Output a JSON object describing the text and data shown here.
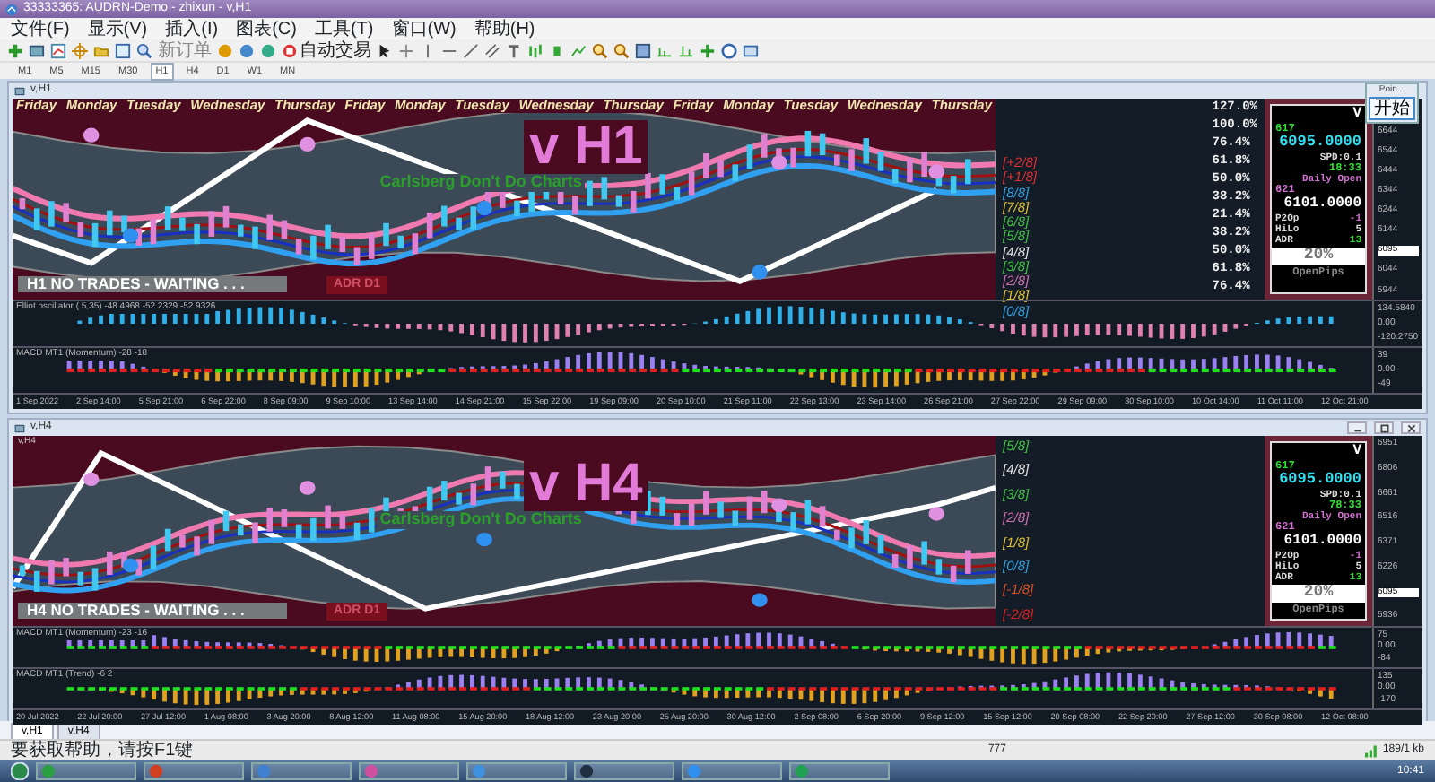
{
  "window": {
    "title": "33333365: AUDRN-Demo - zhixun - v,H1"
  },
  "menu": [
    "文件(F)",
    "显示(V)",
    "插入(I)",
    "图表(C)",
    "工具(T)",
    "窗口(W)",
    "帮助(H)"
  ],
  "toolbar": {
    "new_order": "新订单",
    "autotrading": "自动交易"
  },
  "timeframes": [
    {
      "label": "M1",
      "selected": false
    },
    {
      "label": "M5",
      "selected": false
    },
    {
      "label": "M15",
      "selected": false
    },
    {
      "label": "M30",
      "selected": false
    },
    {
      "label": "H1",
      "selected": true
    },
    {
      "label": "H4",
      "selected": false
    },
    {
      "label": "D1",
      "selected": false
    },
    {
      "label": "W1",
      "selected": false
    },
    {
      "label": "MN",
      "selected": false
    }
  ],
  "charts": [
    {
      "title": "v,H1",
      "controls": false,
      "watermark": "v H1",
      "tagline": "Carlsberg Don't Do Charts",
      "status": "H1  NO TRADES - WAITING . . .",
      "adr_label": "ADR D1",
      "days": [
        "Friday",
        "Monday",
        "Tuesday",
        "Wednesday",
        "Thursday",
        "Friday",
        "Monday",
        "Tuesday",
        "Wednesday",
        "Thursday",
        "Friday",
        "Monday",
        "Tuesday",
        "Wednesday",
        "Thursday"
      ],
      "murrey": [
        {
          "label": "[+2/8]",
          "color": "#e03030"
        },
        {
          "label": "[+1/8]",
          "color": "#e03030"
        },
        {
          "label": "[8/8]",
          "color": "#30a0e0"
        },
        {
          "label": "[7/8]",
          "color": "#e0c030"
        },
        {
          "label": "[6/8]",
          "color": "#40c040"
        },
        {
          "label": "[5/8]",
          "color": "#40c040"
        },
        {
          "label": "[4/8]",
          "color": "#e0e0e0"
        },
        {
          "label": "[3/8]",
          "color": "#40c040"
        },
        {
          "label": "[2/8]",
          "color": "#d070b0"
        },
        {
          "label": "[1/8]",
          "color": "#e0c030"
        },
        {
          "label": "[0/8]",
          "color": "#30a0e0"
        }
      ],
      "percent_levels": [
        "127.0%",
        "100.0%",
        "76.4%",
        "61.8%",
        "50.0%",
        "38.2%",
        "21.4%",
        "38.2%",
        "50.0%",
        "61.8%",
        "76.4%"
      ],
      "info": {
        "symbol": "V",
        "price_small": "617",
        "price": "6095.0000",
        "spd": "SPD:0.1",
        "timer": "18:33",
        "daily_open_label": "Daily Open",
        "daily_open_small": "621",
        "daily_open": "6101.0000",
        "rows": [
          {
            "label": "P2Op",
            "value": "-1"
          },
          {
            "label": "HiLo",
            "value": "5"
          },
          {
            "label": "ADR",
            "value": "13"
          }
        ],
        "percent": "20%",
        "open_pips": "OpenPips"
      },
      "price_axis": [
        {
          "label": "6644",
          "current": false
        },
        {
          "label": "6544",
          "current": false
        },
        {
          "label": "6444",
          "current": false
        },
        {
          "label": "6344",
          "current": false
        },
        {
          "label": "6244",
          "current": false
        },
        {
          "label": "6144",
          "current": false
        },
        {
          "label": "6095",
          "current": true
        },
        {
          "label": "6044",
          "current": false
        },
        {
          "label": "5944",
          "current": false
        }
      ],
      "sub_panes": [
        {
          "kind": "histogram",
          "title": "Elliot oscillator ( 5,35) -48.4968 -52.2329 -52.9326",
          "axis": [
            "134.5840",
            "0.00",
            "-120.2750"
          ]
        },
        {
          "kind": "macd",
          "title": "MACD MT1 (Momentum) -28 -18",
          "axis": [
            "39",
            "0.00",
            "-49"
          ]
        }
      ],
      "dates": [
        "1 Sep 2022",
        "2 Sep 14:00",
        "5 Sep 21:00",
        "6 Sep 22:00",
        "8 Sep 09:00",
        "9 Sep 10:00",
        "13 Sep 14:00",
        "14 Sep 21:00",
        "15 Sep 22:00",
        "19 Sep 09:00",
        "20 Sep 10:00",
        "21 Sep 11:00",
        "22 Sep 13:00",
        "23 Sep 14:00",
        "26 Sep 21:00",
        "27 Sep 22:00",
        "29 Sep 09:00",
        "30 Sep 10:00",
        "10 Oct 14:00",
        "11 Oct 11:00",
        "12 Oct 21:00"
      ]
    },
    {
      "title": "v,H4",
      "controls": true,
      "inner_label": "v,H4",
      "watermark": "v H4",
      "tagline": "Carlsberg Don't Do Charts",
      "status": "H4  NO TRADES - WAITING . . .",
      "adr_label": "ADR D1",
      "murrey": [
        {
          "label": "[5/8]",
          "color": "#40c040"
        },
        {
          "label": "[4/8]",
          "color": "#e0e0e0"
        },
        {
          "label": "[3/8]",
          "color": "#40c040"
        },
        {
          "label": "[2/8]",
          "color": "#d070b0"
        },
        {
          "label": "[1/8]",
          "color": "#e0c030"
        },
        {
          "label": "[0/8]",
          "color": "#30a0e0"
        },
        {
          "label": "[-1/8]",
          "color": "#e05020"
        },
        {
          "label": "[-2/8]",
          "color": "#e02020"
        }
      ],
      "info": {
        "symbol": "V",
        "price_small": "617",
        "price": "6095.0000",
        "spd": "SPD:0.1",
        "timer": "78:33",
        "daily_open_label": "Daily Open",
        "daily_open_small": "621",
        "daily_open": "6101.0000",
        "rows": [
          {
            "label": "P2Op",
            "value": "-1"
          },
          {
            "label": "HiLo",
            "value": "5"
          },
          {
            "label": "ADR",
            "value": "13"
          }
        ],
        "percent": "20%",
        "open_pips": "OpenPips"
      },
      "price_axis": [
        {
          "label": "6951",
          "current": false
        },
        {
          "label": "6806",
          "current": false
        },
        {
          "label": "6661",
          "current": false
        },
        {
          "label": "6516",
          "current": false
        },
        {
          "label": "6371",
          "current": false
        },
        {
          "label": "6226",
          "current": false
        },
        {
          "label": "6095",
          "current": true
        },
        {
          "label": "5936",
          "current": false
        }
      ],
      "sub_panes": [
        {
          "kind": "macd",
          "title": "MACD MT1 (Momentum) -23 -16",
          "axis": [
            "75",
            "0.00",
            "-84"
          ]
        },
        {
          "kind": "macd",
          "title": "MACD MT1 (Trend) -6 2",
          "axis": [
            "135",
            "0.00",
            "-170"
          ]
        }
      ],
      "dates": [
        "20 Jul 2022",
        "22 Jul 20:00",
        "27 Jul 12:00",
        "1 Aug 08:00",
        "3 Aug 20:00",
        "8 Aug 12:00",
        "11 Aug 08:00",
        "15 Aug 20:00",
        "18 Aug 12:00",
        "23 Aug 20:00",
        "25 Aug 20:00",
        "30 Aug 12:00",
        "2 Sep 08:00",
        "6 Sep 20:00",
        "9 Sep 12:00",
        "15 Sep 12:00",
        "20 Sep 08:00",
        "22 Sep 20:00",
        "27 Sep 12:00",
        "30 Sep 08:00",
        "12 Oct 08:00"
      ]
    }
  ],
  "popup": {
    "title": "Poin...",
    "button": "开始"
  },
  "tabs": [
    {
      "label": "v,H1",
      "selected": true
    },
    {
      "label": "v,H4",
      "selected": false
    }
  ],
  "status_bar": {
    "help": "要获取帮助，请按F1键",
    "connection": "777",
    "traffic": "189/1 kb"
  },
  "taskbar": {
    "clock": "10:41"
  }
}
